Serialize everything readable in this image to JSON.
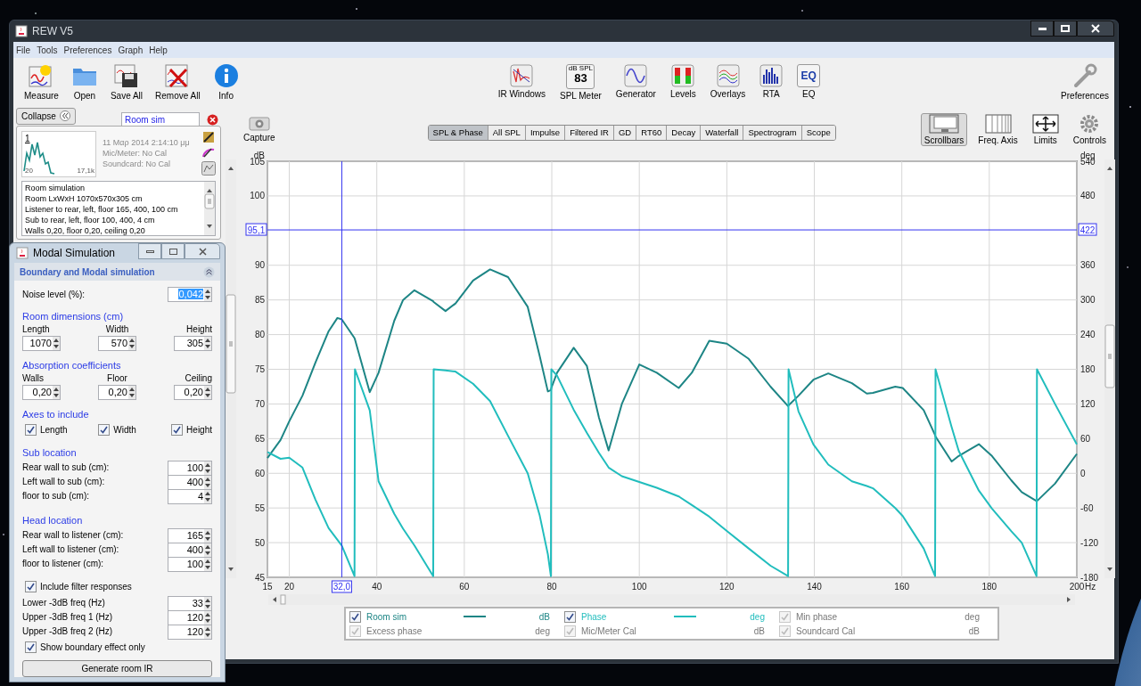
{
  "window": {
    "title": "REW V5"
  },
  "menu": [
    "File",
    "Tools",
    "Preferences",
    "Graph",
    "Help"
  ],
  "toolbar_left": [
    {
      "label": "Measure",
      "kind": "measure"
    },
    {
      "label": "Open",
      "kind": "folder"
    },
    {
      "label": "Save All",
      "kind": "save"
    },
    {
      "label": "Remove All",
      "kind": "remove"
    },
    {
      "label": "Info",
      "kind": "info"
    }
  ],
  "toolbar_center": [
    {
      "label": "IR Windows",
      "kind": "impulse"
    },
    {
      "label": "SPL Meter",
      "kind": "meter",
      "icon_caption": "dB SPL",
      "icon_value": "83"
    },
    {
      "label": "Generator",
      "kind": "sine"
    },
    {
      "label": "Levels",
      "kind": "levels"
    },
    {
      "label": "Overlays",
      "kind": "overlays"
    },
    {
      "label": "RTA",
      "kind": "bars"
    },
    {
      "label": "EQ",
      "kind": "eq",
      "icon_text": "EQ"
    }
  ],
  "toolbar_right": [
    {
      "label": "Preferences",
      "kind": "wrench"
    }
  ],
  "measurement_panel": {
    "collapse": "Collapse",
    "name": "Room sim",
    "thumb": {
      "index": "1",
      "x_start": "20",
      "x_end": "17,1k"
    },
    "info": [
      "11 Μαρ 2014 2:14:10 μμ",
      "Mic/Meter: No Cal",
      "Soundcard: No Cal"
    ],
    "notes": [
      "Room simulation",
      "Room LxWxH 1070x570x305 cm",
      "Listener to rear, left, floor 165, 400, 100 cm",
      "Sub to rear, left, floor 100, 400, 4 cm",
      "Walls 0,20, floor 0,20, ceiling 0,20"
    ]
  },
  "graph": {
    "capture": "Capture",
    "tabs": [
      {
        "label": "SPL & Phase",
        "selected": true
      },
      {
        "label": "All SPL",
        "selected": false
      },
      {
        "label": "Impulse",
        "selected": false
      },
      {
        "label": "Filtered IR",
        "selected": false
      },
      {
        "label": "GD",
        "selected": false
      },
      {
        "label": "RT60",
        "selected": false
      },
      {
        "label": "Decay",
        "selected": false
      },
      {
        "label": "Waterfall",
        "selected": false
      },
      {
        "label": "Spectrogram",
        "selected": false
      },
      {
        "label": "Scope",
        "selected": false
      }
    ],
    "tools": [
      {
        "label": "Scrollbars",
        "kind": "scrollbars",
        "selected": true
      },
      {
        "label": "Freq. Axis",
        "kind": "freq",
        "selected": false
      },
      {
        "label": "Limits",
        "kind": "limits",
        "selected": false
      },
      {
        "label": "Controls",
        "kind": "gear",
        "selected": false
      }
    ],
    "chart_data": {
      "type": "line",
      "xlabel": "Hz",
      "ylabel": "dB",
      "y2label": "deg",
      "xlim": [
        15,
        200
      ],
      "ylim": [
        45,
        105
      ],
      "y2lim": [
        -180,
        540
      ],
      "xticks": [
        15,
        20,
        40,
        60,
        80,
        100,
        120,
        140,
        160,
        180,
        200
      ],
      "yticks": [
        45,
        50,
        55,
        60,
        65,
        70,
        75,
        80,
        85,
        90,
        100,
        105
      ],
      "y2ticks": [
        -180,
        -120,
        -60,
        0,
        60,
        120,
        180,
        240,
        300,
        360,
        480,
        540
      ],
      "x": [
        15,
        18,
        20,
        23,
        26,
        29,
        31,
        32,
        34.9,
        35,
        38.4,
        40.4,
        44,
        46,
        48.6,
        52.9,
        53,
        55.7,
        58,
        62,
        65.9,
        70,
        74.5,
        77.2,
        79.1,
        79.8,
        79.9,
        81.2,
        85,
        88,
        90.8,
        93,
        96,
        100,
        104,
        109,
        112,
        116,
        120,
        125,
        130,
        134,
        134.1,
        136.4,
        139.8,
        143.2,
        148.6,
        152,
        153.4,
        158.5,
        160.2,
        165,
        167.6,
        167.7,
        171.4,
        173,
        177.6,
        180.6,
        185,
        187.4,
        190.8,
        190.9,
        195,
        200
      ],
      "series": [
        {
          "name": "Room sim",
          "color": "#1d8585",
          "values": [
            62.2,
            64.8,
            67.5,
            71.2,
            76,
            80.5,
            82.4,
            82.2,
            79.5,
            79.3,
            71.7,
            74.5,
            82,
            85,
            86.4,
            84.8,
            84.7,
            83.4,
            84.5,
            87.8,
            89.4,
            88.3,
            84,
            77,
            71.8,
            72,
            72.3,
            74.5,
            78.1,
            75.5,
            68,
            63.3,
            70,
            75.7,
            74.5,
            72.3,
            74.5,
            79.1,
            78.7,
            76.5,
            72.5,
            69.7,
            69.8,
            71.2,
            73.5,
            74.4,
            73,
            71.5,
            71.6,
            72.5,
            72.3,
            69.1,
            65.5,
            65.3,
            61.7,
            62.5,
            64.2,
            62.5,
            59,
            57.3,
            56,
            56,
            58.5,
            62.8
          ]
        },
        {
          "name": "Phase",
          "color": "#21bdbd",
          "axis": "y2",
          "values": [
            37,
            25,
            27,
            10,
            -46,
            -95,
            -115,
            -125,
            -178,
            180,
            109,
            -14,
            -70,
            -96,
            -125,
            -178,
            180,
            178,
            176,
            155,
            125,
            65,
            0,
            -72,
            -140,
            -178,
            180,
            169,
            110,
            70,
            35,
            10,
            -5,
            -15,
            -25,
            -40,
            -55,
            -75,
            -100,
            -130,
            -160,
            -178,
            180,
            107,
            50,
            15,
            -14,
            -22,
            -26,
            -60,
            -74,
            -130,
            -178,
            180,
            80,
            39,
            -30,
            -61,
            -100,
            -120,
            -178,
            180,
            120,
            50
          ]
        }
      ],
      "grid": true,
      "ref_lines": [
        {
          "axis": "x",
          "value": 32,
          "label": "32,0"
        },
        {
          "axis": "y",
          "value": 95.1,
          "label": "95,1"
        }
      ],
      "annotations": [
        {
          "text": "422",
          "x": 200,
          "y": 95.1
        }
      ]
    },
    "legend": [
      {
        "kind": "series",
        "checked": true,
        "enabled": true,
        "unit": "dB"
      },
      {
        "kind": "series",
        "checked": true,
        "enabled": true,
        "unit": "deg"
      },
      {
        "label": "Min phase",
        "checked": true,
        "enabled": false,
        "unit": "deg"
      },
      {
        "label": "Excess phase",
        "checked": true,
        "enabled": false,
        "unit": "deg"
      },
      {
        "label": "Mic/Meter Cal",
        "checked": true,
        "enabled": false,
        "unit": "dB"
      },
      {
        "label": "Soundcard Cal",
        "checked": true,
        "enabled": false,
        "unit": "dB"
      }
    ]
  },
  "dialog": {
    "title": "Modal Simulation",
    "section": "Boundary and Modal simulation",
    "noise": {
      "label": "Noise level (%):",
      "value": "0,042",
      "highlighted": true
    },
    "grids": [
      {
        "title": "Room dimensions (cm)",
        "fields": [
          {
            "label": "Length",
            "value": "1070"
          },
          {
            "label": "Width",
            "value": "570"
          },
          {
            "label": "Height",
            "value": "305"
          }
        ]
      },
      {
        "title": "Absorption coefficients",
        "fields": [
          {
            "label": "Walls",
            "value": "0,20"
          },
          {
            "label": "Floor",
            "value": "0,20"
          },
          {
            "label": "Ceiling",
            "value": "0,20"
          }
        ]
      }
    ],
    "axes": {
      "title": "Axes to include",
      "items": [
        {
          "label": "Length",
          "checked": true
        },
        {
          "label": "Width",
          "checked": true
        },
        {
          "label": "Height",
          "checked": true
        }
      ]
    },
    "locations": [
      {
        "title": "Sub location",
        "fields": [
          {
            "label": "Rear wall to sub (cm):",
            "value": "100"
          },
          {
            "label": "Left wall to sub (cm):",
            "value": "400"
          },
          {
            "label": "floor to sub (cm):",
            "value": "4"
          }
        ]
      },
      {
        "title": "Head location",
        "fields": [
          {
            "label": "Rear wall to listener (cm):",
            "value": "165"
          },
          {
            "label": "Left wall to listener (cm):",
            "value": "400"
          },
          {
            "label": "floor to listener (cm):",
            "value": "100"
          }
        ]
      }
    ],
    "filter": {
      "label": "Include filter responses",
      "checked": true
    },
    "filter_fields": [
      {
        "label": "Lower -3dB freq (Hz)",
        "value": "33"
      },
      {
        "label": "Upper -3dB freq 1 (Hz)",
        "value": "120"
      },
      {
        "label": "Upper -3dB freq 2 (Hz)",
        "value": "120"
      }
    ],
    "boundary_only": {
      "label": "Show boundary effect only",
      "checked": true
    },
    "button": "Generate room IR"
  }
}
